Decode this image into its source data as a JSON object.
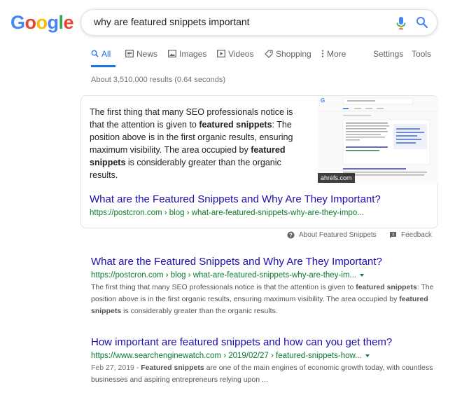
{
  "logo": {
    "letters": [
      "G",
      "o",
      "o",
      "g",
      "l",
      "e"
    ]
  },
  "search": {
    "query": "why are featured snippets important"
  },
  "tabs": {
    "all": "All",
    "news": "News",
    "images": "Images",
    "videos": "Videos",
    "shopping": "Shopping",
    "more": "More",
    "settings": "Settings",
    "tools": "Tools"
  },
  "stats": "About 3,510,000 results (0.64 seconds)",
  "featured": {
    "text_parts": [
      "The first thing that many SEO professionals notice is that the attention is given to ",
      "featured snippets",
      ": The position above is in the first organic results, ensuring maximum visibility. The area occupied by ",
      "featured snippets",
      " is considerably greater than the organic results."
    ],
    "image_caption": "ahrefs.com",
    "title": "What are the Featured Snippets and Why Are They Important?",
    "url": "https://postcron.com › blog › what-are-featured-snippets-why-are-they-impo..."
  },
  "about_fs": "About Featured Snippets",
  "feedback": "Feedback",
  "results": [
    {
      "title": "What are the Featured Snippets and Why Are They Important?",
      "url": "https://postcron.com › blog › what-are-featured-snippets-why-are-they-im...",
      "desc_parts": [
        "The first thing that many SEO professionals notice is that the attention is given to ",
        "featured snippets",
        ": The position above is in the first organic results, ensuring maximum visibility. The area occupied by ",
        "featured snippets",
        " is considerably greater than the organic results."
      ]
    },
    {
      "title": "How important are featured snippets and how can you get them?",
      "url": "https://www.searchenginewatch.com › 2019/02/27 › featured-snippets-how...",
      "date": "Feb 27, 2019 - ",
      "desc_parts": [
        "Featured snippets",
        " are one of the main engines of economic growth today, with countless businesses and aspiring entrepreneurs relying upon ..."
      ]
    }
  ],
  "colors": {
    "link": "#1a0dab",
    "url": "#0b7a2e",
    "accent": "#1a73e8",
    "muted": "#70757a"
  }
}
